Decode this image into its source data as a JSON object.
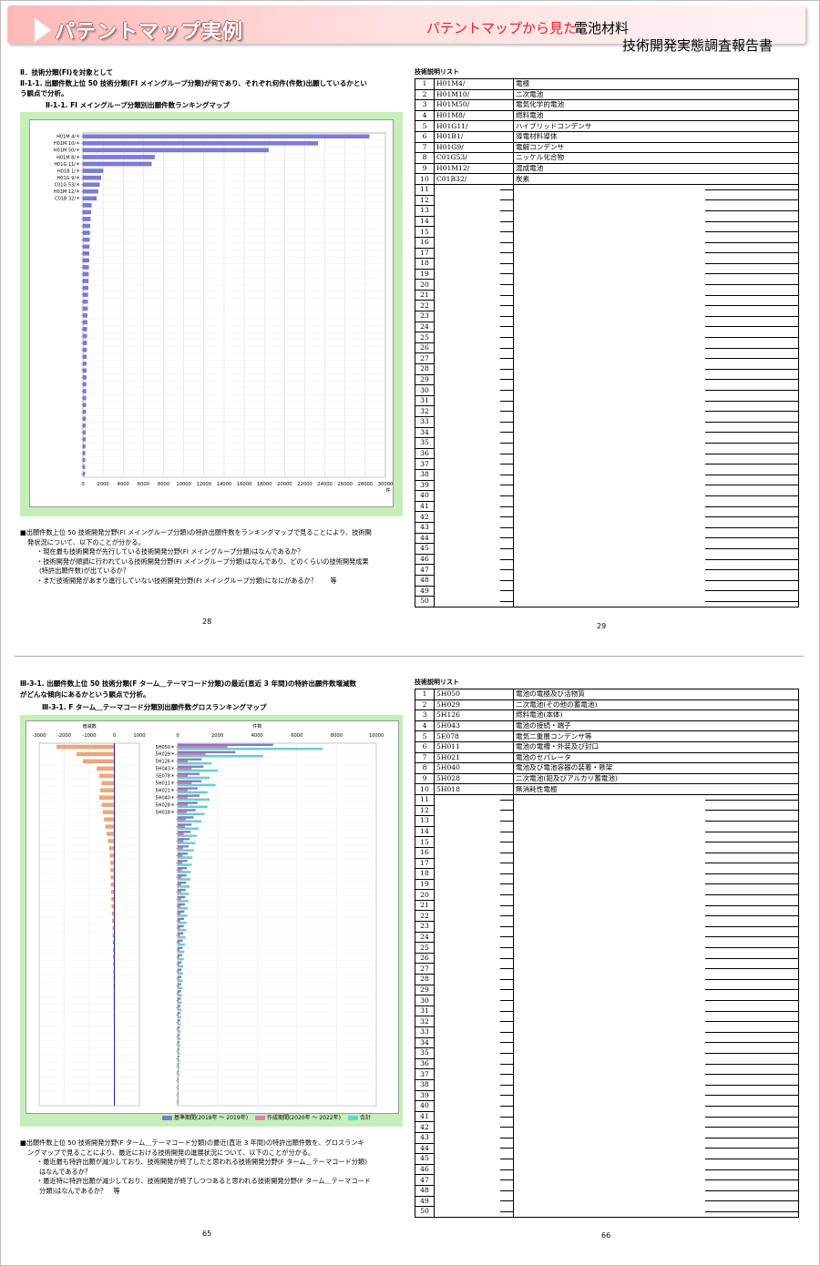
{
  "header": {
    "title": "パテントマップ実例",
    "subtitle_pink": "パテントマップから見た",
    "subtitle_main": "電池材料",
    "subtitle_sub": "技術開発実態調査報告書"
  },
  "section1": {
    "heading1": "Ⅱ．技術分類(FI)を対象として",
    "heading2a": "Ⅱ-1-1. 出願件数上位 50 技術分類(FI メイングループ分類)が何であり、それぞれ何件(件数)出願しているかとい",
    "heading2b": "う観点で分析。",
    "chart_title": "Ⅱ-1-1. FI メイングループ分類別出願件数ランキングマップ",
    "note_lines": [
      "■出願件数上位 50 技術開発分野(FI メイングループ分類)の特許出願件数をランキングマップで見ることにより、技術開",
      "発状況について、以下のことが分かる。",
      "・現在最も技術開発が先行している技術開発分野(FI メイングループ分類)はなんであるか？",
      "・技術開発が順調に行われている技術開発分野(FI メイングループ分類)はなんであり、どのくらいの技術開発成果",
      "(特許出願件数)が出ているか？",
      "・まだ技術開発があまり進行していない技術開発分野(FI メイングループ分類)になにがあるか？　　等"
    ],
    "page_left": "28",
    "page_right": "29"
  },
  "table1": {
    "title": "技術説明リスト",
    "rows": [
      {
        "no": "1",
        "code": "H01M4/",
        "desc": "電極"
      },
      {
        "no": "2",
        "code": "H01M10/",
        "desc": "二次電池"
      },
      {
        "no": "3",
        "code": "H01M50/",
        "desc": "電気化学的電池"
      },
      {
        "no": "4",
        "code": "H01M8/",
        "desc": "燃料電池"
      },
      {
        "no": "5",
        "code": "H01G11/",
        "desc": "ハイブリッドコンデンサ"
      },
      {
        "no": "6",
        "code": "H01B1/",
        "desc": "導電材料導体"
      },
      {
        "no": "7",
        "code": "H01G9/",
        "desc": "電解コンデンサ"
      },
      {
        "no": "8",
        "code": "C01G53/",
        "desc": "ニッケル化合物"
      },
      {
        "no": "9",
        "code": "H01M12/",
        "desc": "混成電池"
      },
      {
        "no": "10",
        "code": "C01B32/",
        "desc": "炭素"
      }
    ]
  },
  "section2": {
    "heading_a": "Ⅲ-3-1. 出願件数上位 50 技術分類(F ターム＿テーマコード分類)の最近(直近 3 年間)の特許出願件数増減数",
    "heading_b": "がどんな傾向にあるかという観点で分析。",
    "chart_title": "Ⅲ-3-1. F ターム＿テーマコード分類別出願件数グロスランキングマップ",
    "note_lines": [
      "■出願件数上位 50 技術開発分野(F ターム＿テーマコード分類)の最近(直近 3 年間)の特許出願件数を、グロスランキ",
      "ングマップで見ることにより、最近における技術開発の進展状況について、以下のことが分かる。",
      "・最近最も特許出願が減少しており、技術開発が終了したと思われる技術開発分野(F ターム＿テーマコード分類)",
      "はなんであるか？",
      "・最近特に特許出願が減少しており、技術開発が終了しつつあると思われる技術開発分野(F ターム＿テーマコード",
      "分類)はなんであるか？　等"
    ],
    "page_left": "65",
    "page_right": "66"
  },
  "table2": {
    "title": "技術説明リスト",
    "rows": [
      {
        "no": "1",
        "code": "5H050",
        "desc": "電池の電極及び活物質"
      },
      {
        "no": "2",
        "code": "5H029",
        "desc": "二次電池(その他の蓄電池)"
      },
      {
        "no": "3",
        "code": "5H126",
        "desc": "燃料電池(本体)"
      },
      {
        "no": "4",
        "code": "5H043",
        "desc": "電池の接続・端子"
      },
      {
        "no": "5",
        "code": "5E078",
        "desc": "電気二重層コンデンサ等"
      },
      {
        "no": "6",
        "code": "5H011",
        "desc": "電池の電槽・外装及び封口"
      },
      {
        "no": "7",
        "code": "5H021",
        "desc": "電池のセパレータ"
      },
      {
        "no": "8",
        "code": "5H040",
        "desc": "電池及び電池容器の装着・懸架"
      },
      {
        "no": "9",
        "code": "5H028",
        "desc": "二次電池(鉛及びアルカリ蓄電池)"
      },
      {
        "no": "10",
        "code": "5H018",
        "desc": "無消耗性電極"
      }
    ]
  },
  "chart_data": [
    {
      "type": "bar",
      "orientation": "horizontal",
      "categories": [
        "H01M 4/＊",
        "H01M 10/＊",
        "H01M 50/＊",
        "H01M 8/＊",
        "H01G 11/＊",
        "H01B 1/＊",
        "H01G 9/＊",
        "C01G 53/＊",
        "H01M 12/＊",
        "C01B 32/＊"
      ],
      "values": [
        28400,
        23300,
        18400,
        7100,
        6800,
        2000,
        1800,
        1650,
        1500,
        1350,
        850,
        800,
        750,
        700,
        680,
        660,
        640,
        620,
        600,
        580,
        560,
        540,
        520,
        500,
        480,
        460,
        440,
        420,
        400,
        390,
        380,
        370,
        360,
        350,
        340,
        330,
        320,
        310,
        300,
        290,
        280,
        270,
        260,
        250,
        240,
        230,
        220,
        210,
        200,
        190
      ],
      "xlim": [
        0,
        30000
      ],
      "xticks": [
        "0",
        "2000",
        "4000",
        "6000",
        "8000",
        "10000",
        "12000",
        "14000",
        "16000",
        "18000",
        "20000",
        "22000",
        "24000",
        "26000",
        "28000",
        "30000"
      ],
      "xunit": "件",
      "color": "#7b7bd9"
    },
    {
      "type": "bar",
      "orientation": "horizontal",
      "categories": [
        "5H050＊",
        "5H029＊",
        "5H126＊",
        "5H043＊",
        "5E078＊",
        "5H011＊",
        "5H021＊",
        "5H040＊",
        "5H028＊",
        "5H018＊"
      ],
      "left_panel": {
        "label": "増減数",
        "xlim": [
          -3000,
          1000
        ],
        "xticks": [
          "-3000",
          "-2000",
          "-1000",
          "0",
          "1000"
        ],
        "values": [
          -2300,
          -1500,
          -1250,
          -700,
          -600,
          -500,
          -550,
          -600,
          -500,
          -450,
          -400,
          -350,
          -300,
          -250,
          -200,
          -180,
          -160,
          -150,
          -140,
          -130,
          -120,
          -110,
          -100,
          -90,
          -80,
          -70,
          -60,
          -55,
          -50,
          -45,
          -40,
          -35,
          -30,
          -28,
          -26,
          -24,
          -22,
          -20,
          -18,
          -16,
          -14,
          -12,
          -10,
          -9,
          -8,
          -7,
          -6,
          -5,
          -4,
          -3
        ]
      },
      "right_panel": {
        "label": "件数",
        "xlim": [
          0,
          10000
        ],
        "xticks": [
          "0",
          "2000",
          "4000",
          "6000",
          "8000",
          "10000"
        ],
        "series": [
          {
            "name": "基準期間(2018年 ～ 2019年)",
            "color": "#7b7bd9",
            "values": [
              4800,
              2900,
              1200,
              1300,
              1100,
              1200,
              1000,
              1100,
              1000,
              900,
              800,
              700,
              650,
              600,
              550,
              500,
              480,
              460,
              440,
              420,
              400,
              380,
              360,
              340,
              320,
              300,
              280,
              260,
              240,
              220,
              200,
              190,
              180,
              170,
              160,
              150,
              140,
              130,
              120,
              110,
              100,
              90,
              80,
              70,
              60,
              50,
              45,
              40,
              35,
              30
            ]
          },
          {
            "name": "作成期間(2020年 ～ 2022年)",
            "color": "#e07bb0",
            "values": [
              2500,
              1400,
              500,
              700,
              500,
              700,
              500,
              500,
              500,
              450,
              400,
              350,
              300,
              280,
              260,
              240,
              220,
              200,
              190,
              180,
              170,
              160,
              150,
              140,
              130,
              120,
              110,
              100,
              90,
              80,
              75,
              70,
              65,
              60,
              55,
              50,
              45,
              40,
              35,
              30,
              28,
              26,
              24,
              22,
              20,
              18,
              16,
              14,
              12,
              10
            ]
          },
          {
            "name": "合計",
            "color": "#5ed6d6",
            "values": [
              7300,
              4300,
              1700,
              2000,
              1600,
              1900,
              1500,
              1600,
              1500,
              1350,
              1200,
              1050,
              950,
              880,
              810,
              740,
              700,
              660,
              630,
              600,
              570,
              540,
              510,
              480,
              450,
              420,
              390,
              360,
              330,
              300,
              275,
              260,
              245,
              230,
              215,
              200,
              185,
              170,
              155,
              140,
              128,
              116,
              104,
              92,
              80,
              68,
              61,
              54,
              47,
              40
            ]
          }
        ]
      }
    }
  ]
}
